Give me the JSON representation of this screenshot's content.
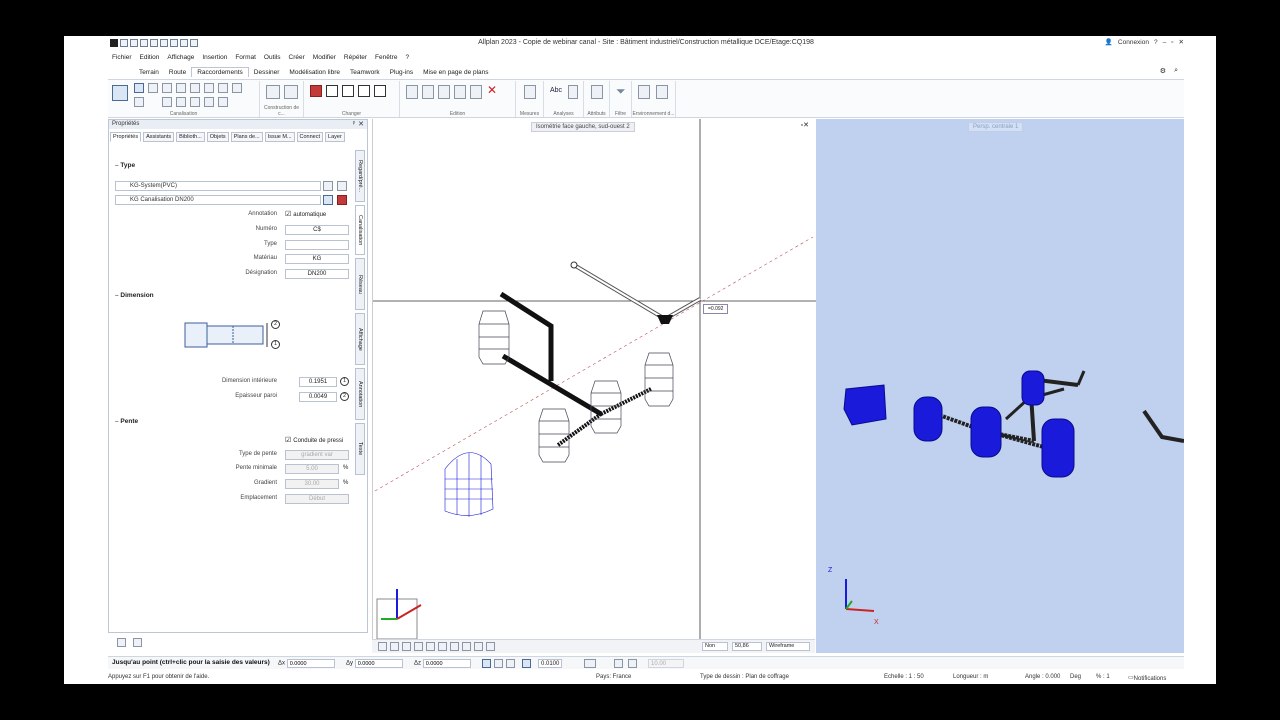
{
  "app_title": "Allplan 2023 - Copie de webinar canal - Site : Bâtiment industriel/Construction métallique DCE/Etage:CQ198",
  "title_right": {
    "login": "Connexion"
  },
  "menu": [
    "Fichier",
    "Edition",
    "Affichage",
    "Insertion",
    "Format",
    "Outils",
    "Créer",
    "Modifier",
    "Répéter",
    "Fenêtre",
    "?"
  ],
  "ribbon_tabs": [
    "Terrain",
    "Route",
    "Raccordements",
    "Dessiner",
    "Modélisation libre",
    "Teamwork",
    "Plug-ins",
    "Mise en page de plans"
  ],
  "ribbon_active": "Raccordements",
  "ribbon_groups": [
    "Canalisation",
    "Construction de c...",
    "Changer",
    "Edition",
    "Mesures",
    "Analyses",
    "Attributs",
    "Filtre",
    "Environnement d..."
  ],
  "properties": {
    "header": "Propriétés",
    "tabs": [
      "Propriétés",
      "Assistants",
      "Biblioth...",
      "Objets",
      "Plans de...",
      "Issue M...",
      "Connect",
      "Layer"
    ],
    "side_tabs": [
      "Regard/pré...",
      "Canalisation",
      "Réseau",
      "Affichage",
      "Annotation",
      "Texte"
    ],
    "type_section": "Type",
    "system": "KG-System(PVC)",
    "pipe": "KG Canalisation DN200",
    "annotation_label": "Annotation",
    "annotation_value": "automatique",
    "numero_label": "Numéro",
    "numero_value": "C$",
    "type_label": "Type",
    "type_value": "",
    "materiau_label": "Matériau",
    "materiau_value": "KG",
    "designation_label": "Désignation",
    "designation_value": "DN200",
    "dimension_section": "Dimension",
    "dim_int_label": "Dimension intérieure",
    "dim_int_value": "0.1951",
    "epaisseur_label": "Epaisseur paroi",
    "epaisseur_value": "0.0049",
    "pente_section": "Pente",
    "conduite_label": "Conduite de pressi",
    "type_pente_label": "Type de pente",
    "type_pente_value": "gradient var",
    "pente_min_label": "Pente minimale",
    "pente_min_value": "5.00",
    "gradient_label": "Gradient",
    "gradient_value": "30.00",
    "emplacement_label": "Emplacement",
    "emplacement_value": "Début",
    "unit_pct": "%",
    "marker_1": "1",
    "marker_2": "2"
  },
  "viewport1": {
    "label": "Isométrie face gauche, sud-ouest 2",
    "cursor_tip": "=0.092",
    "bar": {
      "non": "Non",
      "scale": "50,86",
      "mode": "Wireframe"
    }
  },
  "viewport2": {
    "label": "Persp. centrale 1",
    "axis_z": "Z",
    "axis_x": "X"
  },
  "input_line": {
    "prompt": "Jusqu'au point (ctrl+clic pour la saisie des valeurs)",
    "dx_label": "Δx",
    "dx": "0.0000",
    "dy_label": "Δy",
    "dy": "0.0000",
    "dz_label": "Δz",
    "dz": "0.0000",
    "snap": "0.0100",
    "angle": "10.00"
  },
  "status": {
    "help": "Appuyez sur F1 pour obtenir de l'aide.",
    "pays": "Pays:  France",
    "type_dessin": "Type de dessin :  Plan de coffrage",
    "echelle": "Echelle :  1 : 50",
    "longueur": "Longueur :  m",
    "angle": "Angle :  0.000",
    "deg": "Deg",
    "pct": "% :  1",
    "notifications": "Notifications"
  },
  "colors": {
    "accent": "#1f3b7a",
    "blue_solid": "#1a1adb",
    "viewport_bg": "#bfd1ef"
  }
}
